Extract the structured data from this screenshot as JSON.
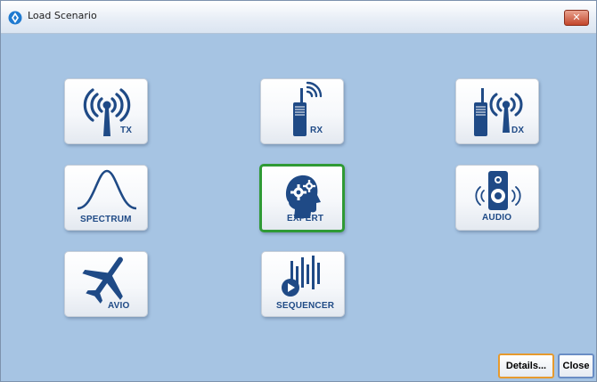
{
  "window": {
    "title": "Load Scenario",
    "close_glyph": "✕"
  },
  "colors": {
    "window_bg": "#a6c4e3",
    "icon_blue": "#1f4a86",
    "selected_border": "#2f9a35",
    "details_focus": "#e69a2e"
  },
  "tiles": [
    {
      "label": "TX",
      "icon": "antenna-tx-icon"
    },
    {
      "label": "RX",
      "icon": "radio-receive-icon"
    },
    {
      "label": "DX",
      "icon": "radio-duplex-icon"
    },
    {
      "label": "SPECTRUM",
      "icon": "spectrum-curve-icon"
    },
    {
      "label": "EXPERT",
      "icon": "expert-head-gears-icon",
      "selected": true
    },
    {
      "label": "AUDIO",
      "icon": "speaker-icon"
    },
    {
      "label": "AVIO",
      "icon": "airplane-icon"
    },
    {
      "label": "SEQUENCER",
      "icon": "sequencer-play-icon"
    }
  ],
  "buttons": {
    "details": "Details...",
    "close": "Close"
  }
}
